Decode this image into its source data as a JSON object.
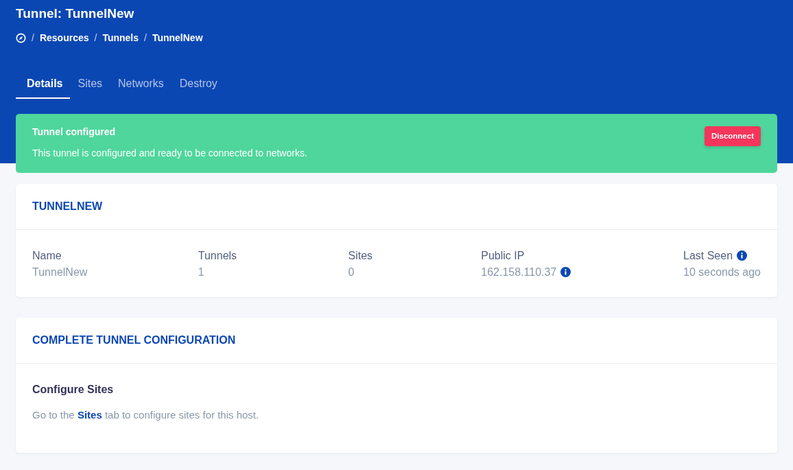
{
  "header": {
    "title": "Tunnel: TunnelNew",
    "breadcrumb": [
      {
        "separator": "/",
        "label": "Resources"
      },
      {
        "separator": "/",
        "label": "Tunnels"
      },
      {
        "separator": "/",
        "label": "TunnelNew"
      }
    ]
  },
  "tabs": [
    {
      "label": "Details",
      "selected": true
    },
    {
      "label": "Sites",
      "selected": false
    },
    {
      "label": "Networks",
      "selected": false
    },
    {
      "label": "Destroy",
      "selected": false
    }
  ],
  "alert": {
    "title": "Tunnel configured",
    "message": "This tunnel is configured and ready to be connected to networks.",
    "button": "Disconnect"
  },
  "summary_card": {
    "title": "TUNNELNEW",
    "fields": [
      {
        "label": "Name",
        "value": "TunnelNew",
        "label_info": false,
        "value_info": false
      },
      {
        "label": "Tunnels",
        "value": "1",
        "label_info": false,
        "value_info": false
      },
      {
        "label": "Sites",
        "value": "0",
        "label_info": false,
        "value_info": false
      },
      {
        "label": "Public IP",
        "value": "162.158.110.37",
        "label_info": false,
        "value_info": true
      },
      {
        "label": "Last Seen",
        "value": "10 seconds ago",
        "label_info": true,
        "value_info": false
      }
    ]
  },
  "config_card": {
    "title": "COMPLETE TUNNEL CONFIGURATION",
    "heading": "Configure Sites",
    "text_before": "Go to the",
    "link": "Sites",
    "text_after": "tab to configure sites for this host."
  }
}
